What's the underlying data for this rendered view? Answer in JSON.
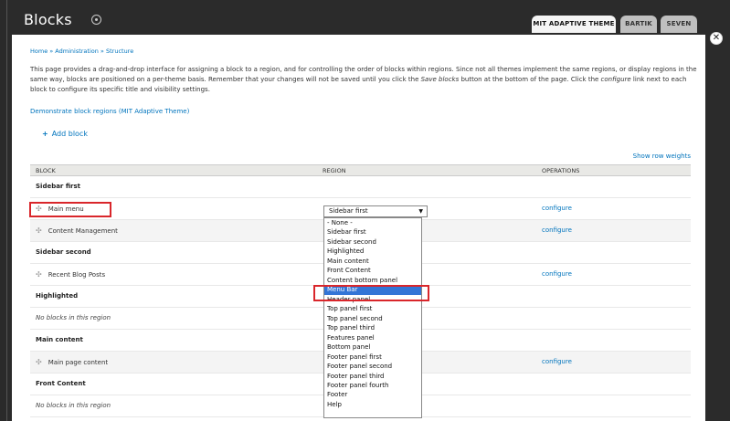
{
  "page": {
    "title": "Blocks"
  },
  "theme_tabs": [
    {
      "label": "MIT ADAPTIVE THEME",
      "active": true
    },
    {
      "label": "BARTIK",
      "active": false
    },
    {
      "label": "SEVEN",
      "active": false
    }
  ],
  "breadcrumb": "Home » Administration » Structure",
  "description": {
    "part1": "This page provides a drag-and-drop interface for assigning a block to a region, and for controlling the order of blocks within regions. Since not all themes implement the same regions, or display regions in the same way, blocks are positioned on a per-theme basis. Remember that your changes will not be saved until you click the ",
    "save_em": "Save blocks",
    "part2": " button at the bottom of the page. Click the ",
    "configure_em": "configure",
    "part3": " link next to each block to configure its specific title and visibility settings."
  },
  "demo_link": "Demonstrate block regions (MIT Adaptive Theme)",
  "add_block": {
    "icon": "plus-icon",
    "label": "Add block"
  },
  "show_row_weights": "Show row weights",
  "table": {
    "headers": {
      "block": "BLOCK",
      "region": "REGION",
      "operations": "OPERATIONS"
    },
    "rows": [
      {
        "type": "region",
        "label": "Sidebar first"
      },
      {
        "type": "block",
        "label": "Main menu",
        "operation": "configure"
      },
      {
        "type": "block",
        "label": "Content Management",
        "operation": "configure"
      },
      {
        "type": "region",
        "label": "Sidebar second"
      },
      {
        "type": "block",
        "label": "Recent Blog Posts",
        "operation": "configure"
      },
      {
        "type": "region",
        "label": "Highlighted"
      },
      {
        "type": "empty",
        "label": "No blocks in this region"
      },
      {
        "type": "region",
        "label": "Main content"
      },
      {
        "type": "block",
        "label": "Main page content",
        "operation": "configure"
      },
      {
        "type": "region",
        "label": "Front Content"
      },
      {
        "type": "empty",
        "label": "No blocks in this region"
      }
    ]
  },
  "region_select": {
    "value": "Sidebar first",
    "options": [
      "- None -",
      "Sidebar first",
      "Sidebar second",
      "Highlighted",
      "Main content",
      "Front Content",
      "Content bottom panel",
      "Menu Bar",
      "Header panel",
      "Top panel first",
      "Top panel second",
      "Top panel third",
      "Features panel",
      "Bottom panel",
      "Footer panel first",
      "Footer panel second",
      "Footer panel third",
      "Footer panel fourth",
      "Footer",
      "Help"
    ],
    "highlighted_option": "Menu Bar"
  },
  "colors": {
    "link": "#0074bd",
    "highlight_box": "#d9262b",
    "selected_option": "#3375d6"
  }
}
